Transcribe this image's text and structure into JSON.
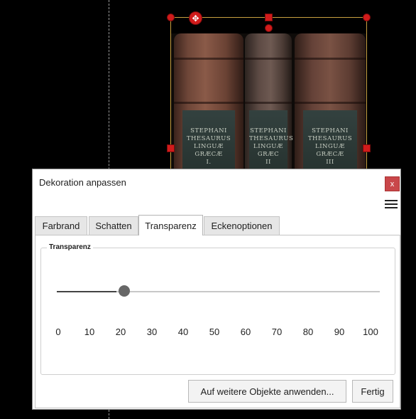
{
  "canvas": {
    "book_labels": [
      [
        "STEPHANI",
        "THESAURUS",
        "LINGUÆ GRÆCÆ",
        "I."
      ],
      [
        "STEPHANI",
        "THESAURUS",
        "LINGUÆ GRÆC",
        "II"
      ],
      [
        "STEPHANI",
        "THESAURUS",
        "LINGUÆ GRÆCÆ",
        "III"
      ]
    ]
  },
  "dialog": {
    "title": "Dekoration anpassen",
    "close_label": "x",
    "tabs": [
      {
        "label": "Farbrand",
        "active": false
      },
      {
        "label": "Schatten",
        "active": false
      },
      {
        "label": "Transparenz",
        "active": true
      },
      {
        "label": "Eckenoptionen",
        "active": false
      }
    ],
    "group_title": "Transparenz",
    "slider": {
      "value": 20,
      "min": 0,
      "max": 100,
      "ticks": [
        "0",
        "10",
        "20",
        "30",
        "40",
        "50",
        "60",
        "70",
        "80",
        "90",
        "100"
      ]
    },
    "apply_button": "Auf weitere Objekte anwenden...",
    "done_button": "Fertig"
  },
  "colors": {
    "handle": "#d11b1b",
    "close_button": "#c9474a",
    "slider_thumb": "#676767"
  },
  "icons": {
    "close": "close-icon",
    "menu": "hamburger-menu-icon",
    "move": "move-arrows-icon"
  }
}
